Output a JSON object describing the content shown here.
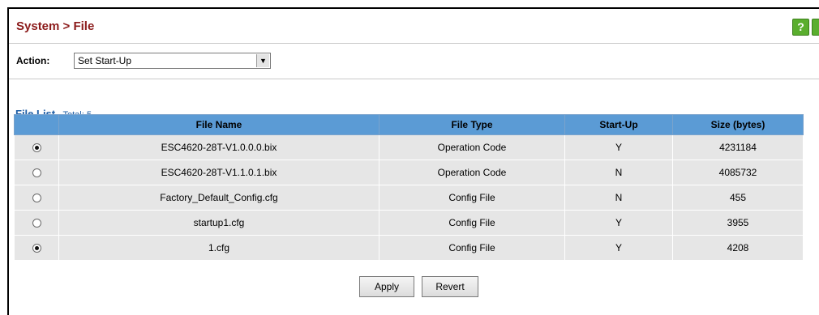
{
  "header": {
    "title": "System > File",
    "help_label": "?"
  },
  "action": {
    "label": "Action:",
    "selected": "Set Start-Up"
  },
  "file_list": {
    "title": "File List",
    "total": "Total: 5",
    "columns": [
      "File Name",
      "File Type",
      "Start-Up",
      "Size (bytes)"
    ],
    "rows": [
      {
        "selected": true,
        "name": "ESC4620-28T-V1.0.0.0.bix",
        "type": "Operation Code",
        "startup": "Y",
        "size": "4231184"
      },
      {
        "selected": false,
        "name": "ESC4620-28T-V1.1.0.1.bix",
        "type": "Operation Code",
        "startup": "N",
        "size": "4085732"
      },
      {
        "selected": false,
        "name": "Factory_Default_Config.cfg",
        "type": "Config File",
        "startup": "N",
        "size": "455"
      },
      {
        "selected": false,
        "name": "startup1.cfg",
        "type": "Config File",
        "startup": "Y",
        "size": "3955"
      },
      {
        "selected": true,
        "name": "1.cfg",
        "type": "Config File",
        "startup": "Y",
        "size": "4208"
      }
    ]
  },
  "buttons": {
    "apply": "Apply",
    "revert": "Revert"
  },
  "colors": {
    "title": "#8b1a1a",
    "header_bg": "#5b9bd5",
    "link": "#1f5fa6",
    "help": "#5aae2e"
  }
}
